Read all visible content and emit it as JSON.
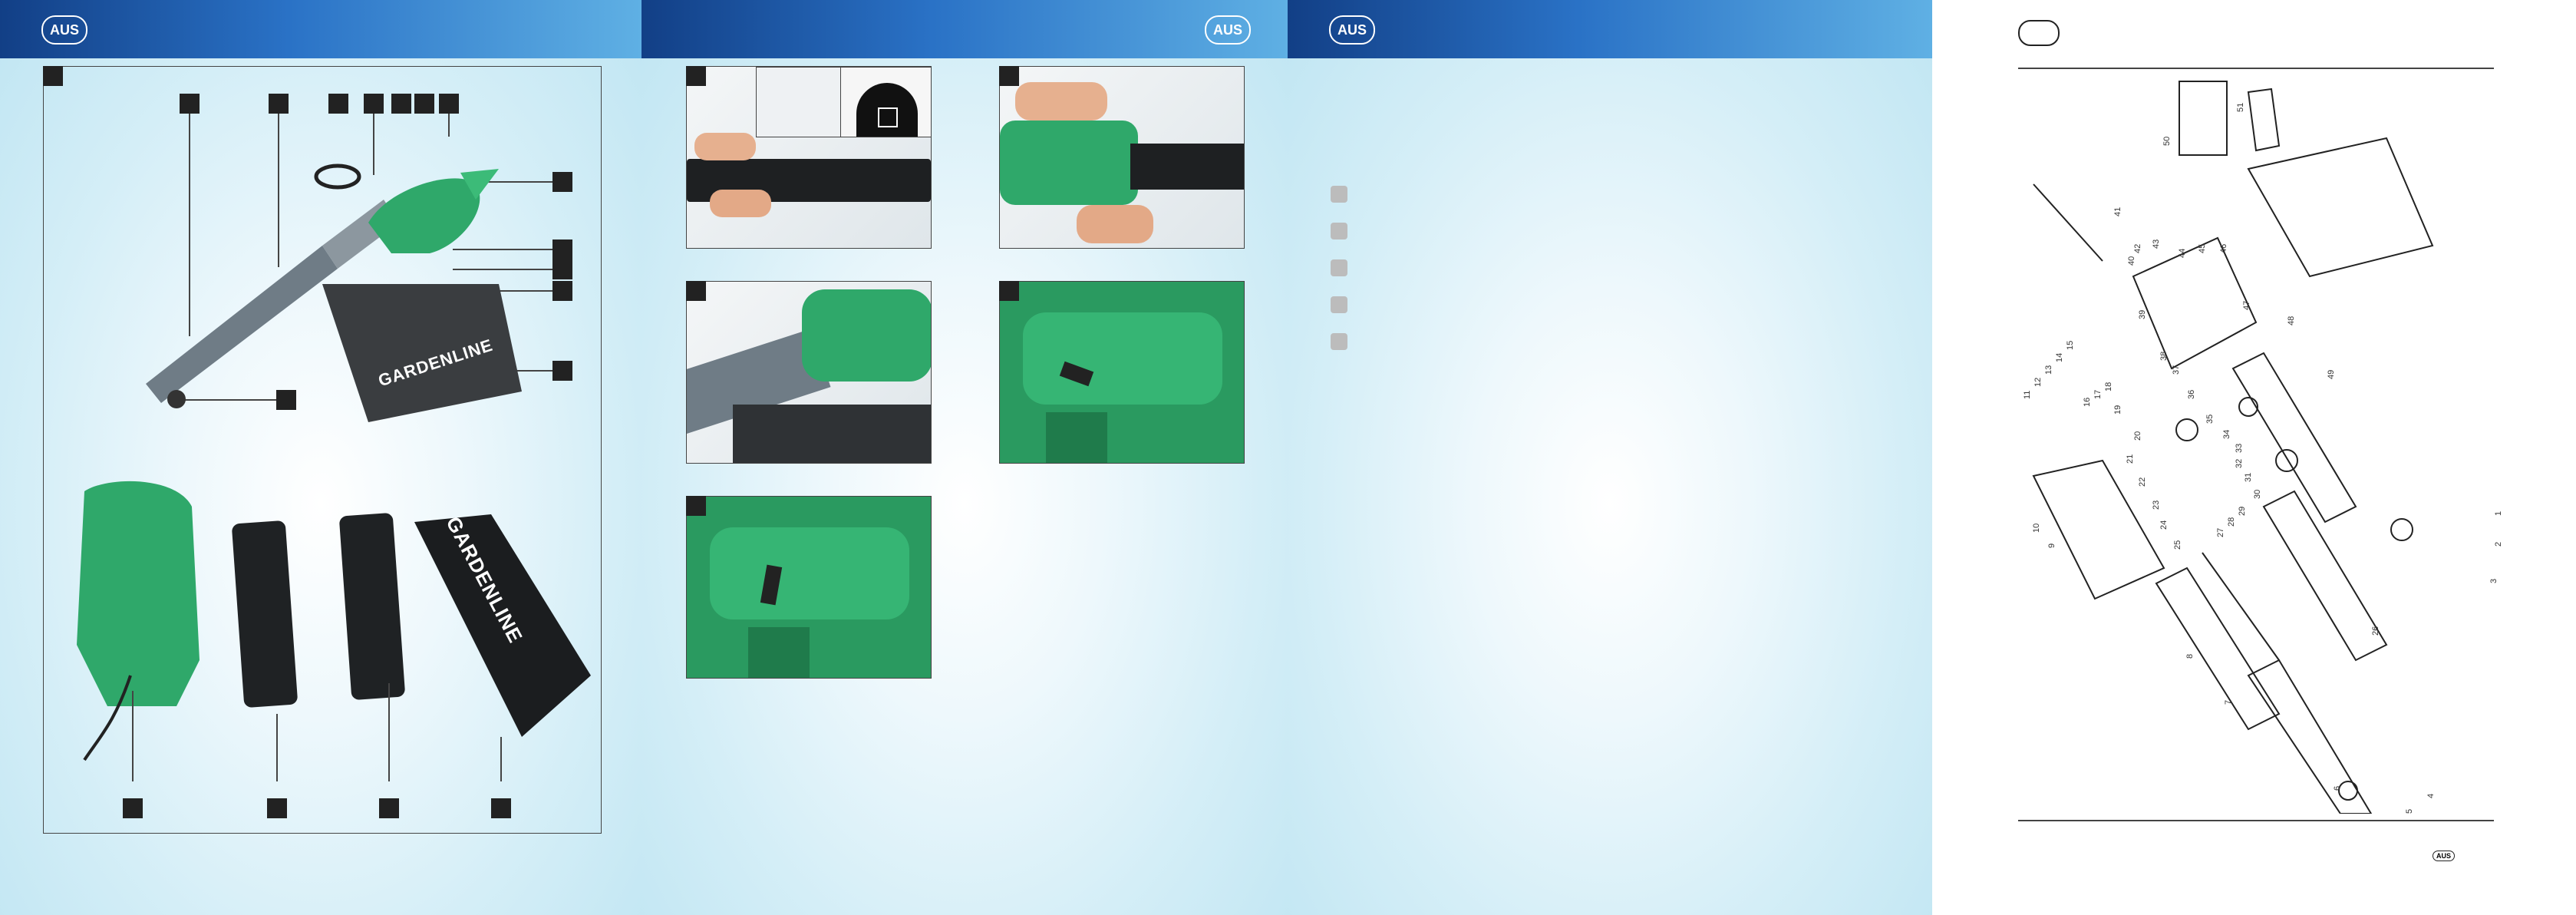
{
  "country_code": "AUS",
  "brand": "GARDENLINE",
  "pages": [
    {
      "id": "page-1",
      "badge": "AUS"
    },
    {
      "id": "page-2",
      "badge": "AUS"
    },
    {
      "id": "page-3",
      "badge": "AUS"
    }
  ],
  "diagram_page": {
    "footer_badge": "AUS",
    "part_numbers": [
      "1",
      "2",
      "3",
      "4",
      "5",
      "6",
      "7",
      "8",
      "9",
      "10",
      "11",
      "12",
      "13",
      "14",
      "15",
      "16",
      "17",
      "18",
      "19",
      "20",
      "21",
      "22",
      "23",
      "24",
      "25",
      "26",
      "27",
      "28",
      "29",
      "30",
      "31",
      "32",
      "33",
      "34",
      "35",
      "36",
      "37",
      "38",
      "39",
      "40",
      "41",
      "42",
      "43",
      "44",
      "45",
      "46",
      "47",
      "48",
      "49",
      "50",
      "51"
    ]
  }
}
